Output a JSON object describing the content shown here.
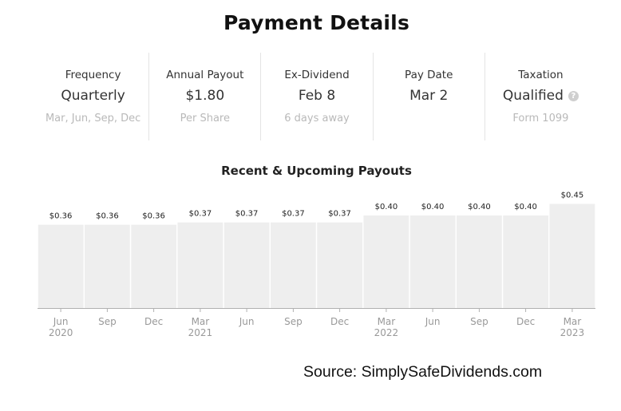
{
  "header": {
    "title": "Payment Details"
  },
  "stats": [
    {
      "label": "Frequency",
      "value": "Quarterly",
      "sub": "Mar, Jun, Sep, Dec"
    },
    {
      "label": "Annual Payout",
      "value": "$1.80",
      "sub": "Per Share"
    },
    {
      "label": "Ex-Dividend",
      "value": "Feb 8",
      "sub": "6 days away"
    },
    {
      "label": "Pay Date",
      "value": "Mar 2",
      "sub": ""
    },
    {
      "label": "Taxation",
      "value": "Qualified",
      "sub": "Form 1099",
      "icon": "question-circle-icon"
    }
  ],
  "chart_data": {
    "type": "bar",
    "title": "Recent & Upcoming Payouts",
    "categories": [
      "Jun 2020",
      "Sep",
      "Dec",
      "Mar 2021",
      "Jun",
      "Sep",
      "Dec",
      "Mar 2022",
      "Jun",
      "Sep",
      "Dec",
      "Mar 2023"
    ],
    "tick_lines": [
      [
        "Jun",
        "2020"
      ],
      [
        "Sep"
      ],
      [
        "Dec"
      ],
      [
        "Mar",
        "2021"
      ],
      [
        "Jun"
      ],
      [
        "Sep"
      ],
      [
        "Dec"
      ],
      [
        "Mar",
        "2022"
      ],
      [
        "Jun"
      ],
      [
        "Sep"
      ],
      [
        "Dec"
      ],
      [
        "Mar",
        "2023"
      ]
    ],
    "values": [
      0.36,
      0.36,
      0.36,
      0.37,
      0.37,
      0.37,
      0.37,
      0.4,
      0.4,
      0.4,
      0.4,
      0.45
    ],
    "data_labels": [
      "$0.36",
      "$0.36",
      "$0.36",
      "$0.37",
      "$0.37",
      "$0.37",
      "$0.37",
      "$0.40",
      "$0.40",
      "$0.40",
      "$0.40",
      "$0.45"
    ],
    "xlabel": "",
    "ylabel": "",
    "grid": false,
    "bar_color": "#eeeeee",
    "axis_color": "#b0b0b0"
  },
  "footer": {
    "source": "Source: SimplySafeDividends.com"
  }
}
